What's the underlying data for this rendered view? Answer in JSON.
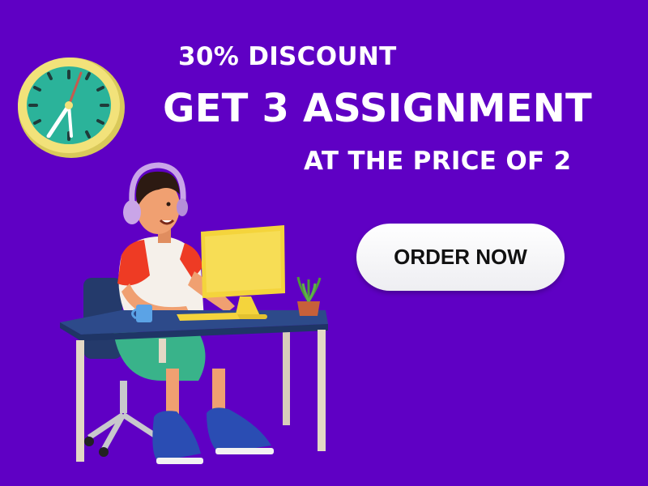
{
  "banner": {
    "discount_text": "30% DISCOUNT",
    "headline_text": "GET 3 ASSIGNMENT",
    "subheadline_text": "AT THE PRICE OF 2",
    "cta_label": "ORDER NOW"
  },
  "colors": {
    "background": "#5f00c4",
    "clock_face": "#2bb39a",
    "clock_rim": "#f2e27a",
    "desk_top": "#2d4a8a",
    "monitor": "#f4d43c",
    "shirt": "#ee3b24"
  },
  "icons": [
    "wall-clock-icon",
    "student-at-desk-illustration"
  ]
}
